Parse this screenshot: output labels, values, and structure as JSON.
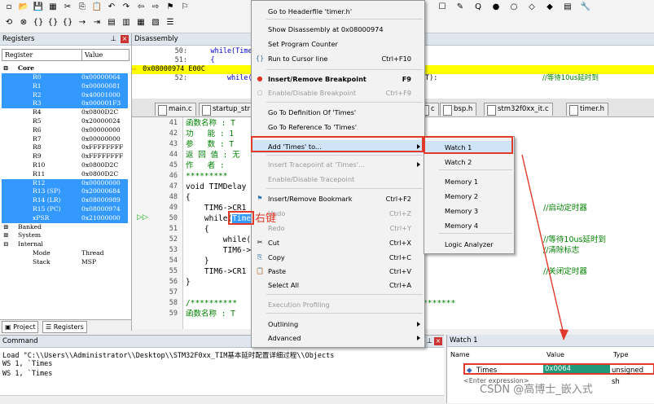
{
  "toolbar1": {
    "icons": [
      "new-file-icon",
      "open-folder-icon",
      "save-icon",
      "save-all-icon",
      "cut-icon",
      "copy-icon",
      "paste-icon",
      "undo-icon",
      "redo-icon",
      "back-icon",
      "forward-icon",
      "bookmark-icon",
      "bookmark-prev-icon"
    ]
  },
  "toolbar2": {
    "icons": [
      "reset-icon",
      "stop-icon",
      "step-into-icon",
      "step-over-icon",
      "step-out-icon",
      "run-to-cursor-icon",
      "show-next-icon",
      "command-window-icon",
      "disassembly-window-icon",
      "symbols-window-icon",
      "registers-window-icon",
      "call-stack-icon"
    ]
  },
  "toolbar_right": {
    "icons": [
      "view-icon",
      "configure-icon",
      "debug-settings-icon",
      "breakpoint-icon",
      "circle-icon",
      "insert-breakpoint-icon",
      "kill-breakpoint-icon",
      "window-icon",
      "wrench-icon"
    ]
  },
  "registers": {
    "title": "Registers",
    "col_register": "Register",
    "col_value": "Value",
    "core_label": "Core",
    "rows": [
      {
        "name": "R0",
        "value": "0x00000064",
        "selected": true
      },
      {
        "name": "R1",
        "value": "0x00000081",
        "selected": true
      },
      {
        "name": "R2",
        "value": "0x40001000",
        "selected": true
      },
      {
        "name": "R3",
        "value": "0x000001F3",
        "selected": true
      },
      {
        "name": "R4",
        "value": "0x0800D2C",
        "selected": false
      },
      {
        "name": "R5",
        "value": "0x20000024",
        "selected": false
      },
      {
        "name": "R6",
        "value": "0x00000000",
        "selected": false
      },
      {
        "name": "R7",
        "value": "0x00000000",
        "selected": false
      },
      {
        "name": "R8",
        "value": "0xFFFFFFFF",
        "selected": false
      },
      {
        "name": "R9",
        "value": "0xFFFFFFFF",
        "selected": false
      },
      {
        "name": "R10",
        "value": "0x0800D2C",
        "selected": false
      },
      {
        "name": "R11",
        "value": "0x0800D2C",
        "selected": false
      },
      {
        "name": "R12",
        "value": "0x00000000",
        "selected": true
      },
      {
        "name": "R13 (SP)",
        "value": "0x20000684",
        "selected": true
      },
      {
        "name": "R14 (LR)",
        "value": "0x08000989",
        "selected": true
      },
      {
        "name": "R15 (PC)",
        "value": "0x08000974",
        "selected": true
      },
      {
        "name": "xPSR",
        "value": "0x21000000",
        "selected": true
      }
    ],
    "banked_label": "Banked",
    "system_label": "System",
    "internal_label": "Internal",
    "mode_label": "Mode",
    "mode_value": "Thread",
    "stack_label": "Stack",
    "stack_value": "MSP"
  },
  "bottom_tabs": {
    "project": "Project",
    "registers": "Registers"
  },
  "disassembly": {
    "title": "Disassembly",
    "lines": [
      {
        "num": "50:",
        "code": "    while(Times"
      },
      {
        "num": "51:",
        "code": "    {"
      },
      {
        "num": "",
        "code": "0x08000974 E00C"
      },
      {
        "num": "52:",
        "code": "        while((TI"
      }
    ],
    "right_fragment": "T):",
    "right_comment": "//等待10us延时到"
  },
  "editor_tabs": [
    {
      "label": "main.c",
      "active": false
    },
    {
      "label": "startup_str",
      "active": false
    },
    {
      "label": "c",
      "active": false
    },
    {
      "label": "bsp.h",
      "active": false
    },
    {
      "label": "stm32f0xx_it.c",
      "active": false
    },
    {
      "label": "timer.h",
      "active": false
    }
  ],
  "code": [
    {
      "num": "41",
      "text": "函数名称 : T"
    },
    {
      "num": "42",
      "text": "功   能 : 1"
    },
    {
      "num": "43",
      "text": "参   数 : T"
    },
    {
      "num": "44",
      "text": "返 回 值 : 无"
    },
    {
      "num": "45",
      "text": "作   者 : "
    },
    {
      "num": "46",
      "text": "*********"
    },
    {
      "num": "47",
      "text": "void TIMDelay"
    },
    {
      "num": "48",
      "text": "{"
    },
    {
      "num": "49",
      "text": "    TIM6->CR1"
    },
    {
      "num": "50",
      "text": "    while("
    },
    {
      "num": "51",
      "text": "    {"
    },
    {
      "num": "52",
      "text": "        while((TI"
    },
    {
      "num": "53",
      "text": "        TIM6->SR"
    },
    {
      "num": "54",
      "text": "    }"
    },
    {
      "num": "55",
      "text": "    TIM6->CR1 &"
    },
    {
      "num": "56",
      "text": "}"
    },
    {
      "num": "57",
      "text": ""
    },
    {
      "num": "58",
      "text": "/**********"
    },
    {
      "num": "59",
      "text": "函数名称 : T"
    }
  ],
  "highlight_word": "Times",
  "right_click_note": "右键",
  "code_comments": {
    "c49": "//启动定时器",
    "c52": "//等待10us延时到",
    "c53": "//清除标志",
    "c55": "//关闭定时器",
    "c58": "**********"
  },
  "context_menu": {
    "items": [
      {
        "label": "Go to Headerfile 'timer.h'",
        "shortcut": "",
        "disabled": false
      },
      {
        "label": "Show Disassembly at 0x08000974",
        "shortcut": "",
        "disabled": false
      },
      {
        "label": "Set Program Counter",
        "shortcut": "",
        "disabled": false
      },
      {
        "label": "Run to Cursor line",
        "shortcut": "Ctrl+F10",
        "disabled": false
      },
      {
        "label": "Insert/Remove Breakpoint",
        "shortcut": "F9",
        "disabled": false
      },
      {
        "label": "Enable/Disable Breakpoint",
        "shortcut": "Ctrl+F9",
        "disabled": true
      },
      {
        "label": "Go To Definition Of 'Times'",
        "shortcut": "",
        "disabled": false
      },
      {
        "label": "Go To Reference To 'Times'",
        "shortcut": "",
        "disabled": false
      },
      {
        "label": "Add 'Times' to...",
        "shortcut": "",
        "disabled": false
      },
      {
        "label": "Insert Tracepoint at 'Times'...",
        "shortcut": "",
        "disabled": true
      },
      {
        "label": "Enable/Disable Tracepoint",
        "shortcut": "",
        "disabled": true
      },
      {
        "label": "Insert/Remove Bookmark",
        "shortcut": "Ctrl+F2",
        "disabled": false
      },
      {
        "label": "Undo",
        "shortcut": "Ctrl+Z",
        "disabled": true
      },
      {
        "label": "Redo",
        "shortcut": "Ctrl+Y",
        "disabled": true
      },
      {
        "label": "Cut",
        "shortcut": "Ctrl+X",
        "disabled": false
      },
      {
        "label": "Copy",
        "shortcut": "Ctrl+C",
        "disabled": false
      },
      {
        "label": "Paste",
        "shortcut": "Ctrl+V",
        "disabled": false
      },
      {
        "label": "Select All",
        "shortcut": "Ctrl+A",
        "disabled": false
      },
      {
        "label": "Execution Profiling",
        "shortcut": "",
        "disabled": true
      },
      {
        "label": "Outlining",
        "shortcut": "",
        "disabled": false
      },
      {
        "label": "Advanced",
        "shortcut": "",
        "disabled": false
      }
    ]
  },
  "submenu": {
    "items": [
      "Watch 1",
      "Watch 2",
      "Memory 1",
      "Memory 2",
      "Memory 3",
      "Memory 4",
      "Logic Analyzer"
    ]
  },
  "command": {
    "title": "Command",
    "lines": [
      "Load \"C:\\\\Users\\\\Administrator\\\\Desktop\\\\STM32F0xx_TIM基本延时配置详细过程\\\\Objects",
      "WS 1, `Times",
      "WS 1, `Times"
    ]
  },
  "watch": {
    "title": "Watch 1",
    "col_name": "Name",
    "col_value": "Value",
    "col_type": "Type",
    "row_name": "Times",
    "row_value": "0x0064",
    "row_type": "unsigned sh",
    "enter_expr": "<Enter expression>"
  },
  "watermark": "CSDN @高博士_嵌入式",
  "colors": {
    "selection": "#3399ff",
    "annotation_red": "#e23a2a",
    "watch_value_bg": "#1e9a7a",
    "comment_green": "#008000"
  }
}
